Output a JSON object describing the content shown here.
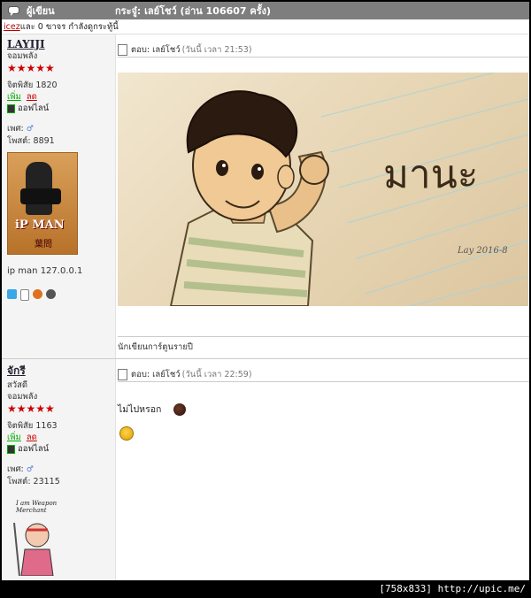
{
  "header": {
    "author_col": "ผู้เขียน",
    "subject": "กระจู๋: เลย์โชว์  (อ่าน 106607 ครั้ง)"
  },
  "viewers": {
    "user": "icez",
    "rest": " และ 0 ขาจร กำลังดูกระทู้นี้"
  },
  "posts": [
    {
      "username": "LAYIJI",
      "rank": "จอมพลัง",
      "stars": "★★★★★",
      "karma_label": "จิตพิสัย 1820",
      "karma_plus": "เพิ่ม",
      "karma_minus": "ลด",
      "status": "ออฟไลน์",
      "gender_label": "เพศ:",
      "gender_icon": "♂",
      "posts_label": "โพสต์: 8891",
      "avatar_title": "iP MAN",
      "avatar_sig": "葉問",
      "personal_text": "ip man 127.0.0.1",
      "reply_prefix": "ตอบ: เลย์โชว์",
      "reply_time": "(วันนี้ เวลา 21:53)",
      "drawing_caption": "มานะ",
      "drawing_signature": "Lay 2016-8",
      "signature": "นักเขียนการ์ตูนรายปี"
    },
    {
      "username": "จักรี",
      "title": "สวัสดี",
      "rank": "จอมพลัง",
      "stars": "★★★★★",
      "karma_label": "จิตพิสัย 1163",
      "karma_plus": "เพิ่ม",
      "karma_minus": "ลด",
      "status": "ออฟไลน์",
      "gender_label": "เพศ:",
      "gender_icon": "♂",
      "posts_label": "โพสต์: 23115",
      "avatar_text": "I am Weapon Merchant",
      "reply_prefix": "ตอบ: เลย์โชว์",
      "reply_time": "(วันนี้ เวลา 22:59)",
      "message": "ไม่ไปหรอก"
    }
  ],
  "footer": "[758x833] http://upic.me/"
}
